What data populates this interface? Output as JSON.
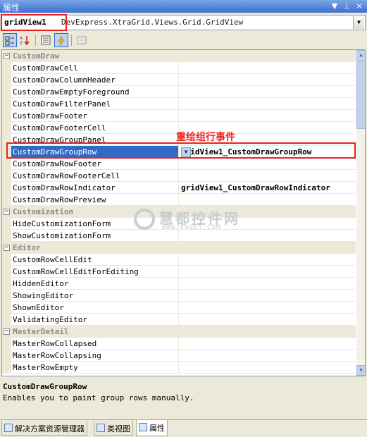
{
  "window": {
    "title": "属性",
    "buttons": [
      "▼",
      "⊥",
      "×"
    ]
  },
  "object_selector": {
    "name": "gridView1",
    "type": "DevExpress.XtraGrid.Views.Grid.GridView",
    "dropdown_glyph": "▼"
  },
  "toolbar": {
    "categorized_icon": "categorized-icon",
    "alphabetical_icon": "alphabetical-icon",
    "properties_icon": "properties-icon",
    "events_icon": "events-lightning-icon",
    "property_pages_icon": "property-pages-icon"
  },
  "categories": {
    "custom_draw": "CustomDraw",
    "customization": "Customization",
    "editor": "Editor",
    "master_detail": "MasterDetail"
  },
  "rows": {
    "r01": "CustomDrawCell",
    "r02": "CustomDrawColumnHeader",
    "r03": "CustomDrawEmptyForeground",
    "r04": "CustomDrawFilterPanel",
    "r05": "CustomDrawFooter",
    "r06": "CustomDrawFooterCell",
    "r07": "CustomDrawGroupPanel",
    "r08": "CustomDrawGroupRow",
    "r08_value": "gridView1_CustomDrawGroupRow",
    "r09": "CustomDrawRowFooter",
    "r10": "CustomDrawRowFooterCell",
    "r11": "CustomDrawRowIndicator",
    "r11_value": "gridView1_CustomDrawRowIndicator",
    "r12": "CustomDrawRowPreview",
    "r13": "HideCustomizationForm",
    "r14": "ShowCustomizationForm",
    "r15": "CustomRowCellEdit",
    "r16": "CustomRowCellEditForEditing",
    "r17": "HiddenEditor",
    "r18": "ShowingEditor",
    "r19": "ShownEditor",
    "r20": "ValidatingEditor",
    "r21": "MasterRowCollapsed",
    "r22": "MasterRowCollapsing",
    "r23": "MasterRowEmpty"
  },
  "annotation": "重绘组行事件",
  "watermark": {
    "text": "慧都控件网",
    "sub": "WWW.EVGET.COM"
  },
  "description": {
    "title": "CustomDrawGroupRow",
    "text": "Enables you to paint group rows manually."
  },
  "tabs": [
    "解决方案资源管理器",
    "类视图",
    "属性"
  ],
  "colors": {
    "selection": "#316ac5",
    "annotation_red": "#e8231f",
    "category_text": "#8a8a8a"
  }
}
